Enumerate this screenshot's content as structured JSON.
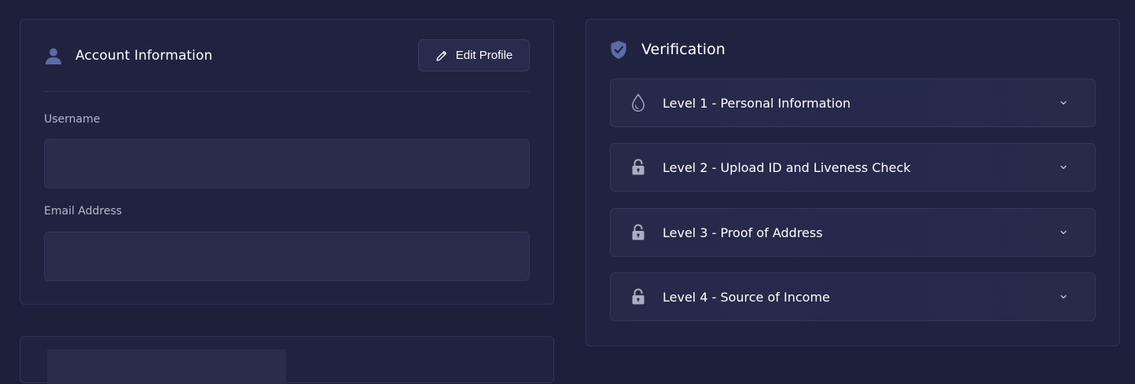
{
  "account": {
    "title": "Account Information",
    "edit_button_label": "Edit Profile",
    "username": {
      "label": "Username",
      "value": "",
      "placeholder": ""
    },
    "email": {
      "label": "Email Address",
      "value": "",
      "placeholder": ""
    },
    "icons": {
      "header": "user-icon",
      "edit": "pencil-icon"
    }
  },
  "verification": {
    "title": "Verification",
    "icon": "shield-check-icon",
    "levels": [
      {
        "label": "Level 1 - Personal Information",
        "icon": "droplet-icon"
      },
      {
        "label": "Level 2 - Upload ID and Liveness Check",
        "icon": "lock-icon"
      },
      {
        "label": "Level 3 - Proof of Address",
        "icon": "lock-icon"
      },
      {
        "label": "Level 4 - Source of Income",
        "icon": "lock-icon"
      }
    ]
  },
  "colors": {
    "background": "#1c1f3a",
    "card": "#20233f",
    "accent_icon": "#5d6aa8"
  }
}
